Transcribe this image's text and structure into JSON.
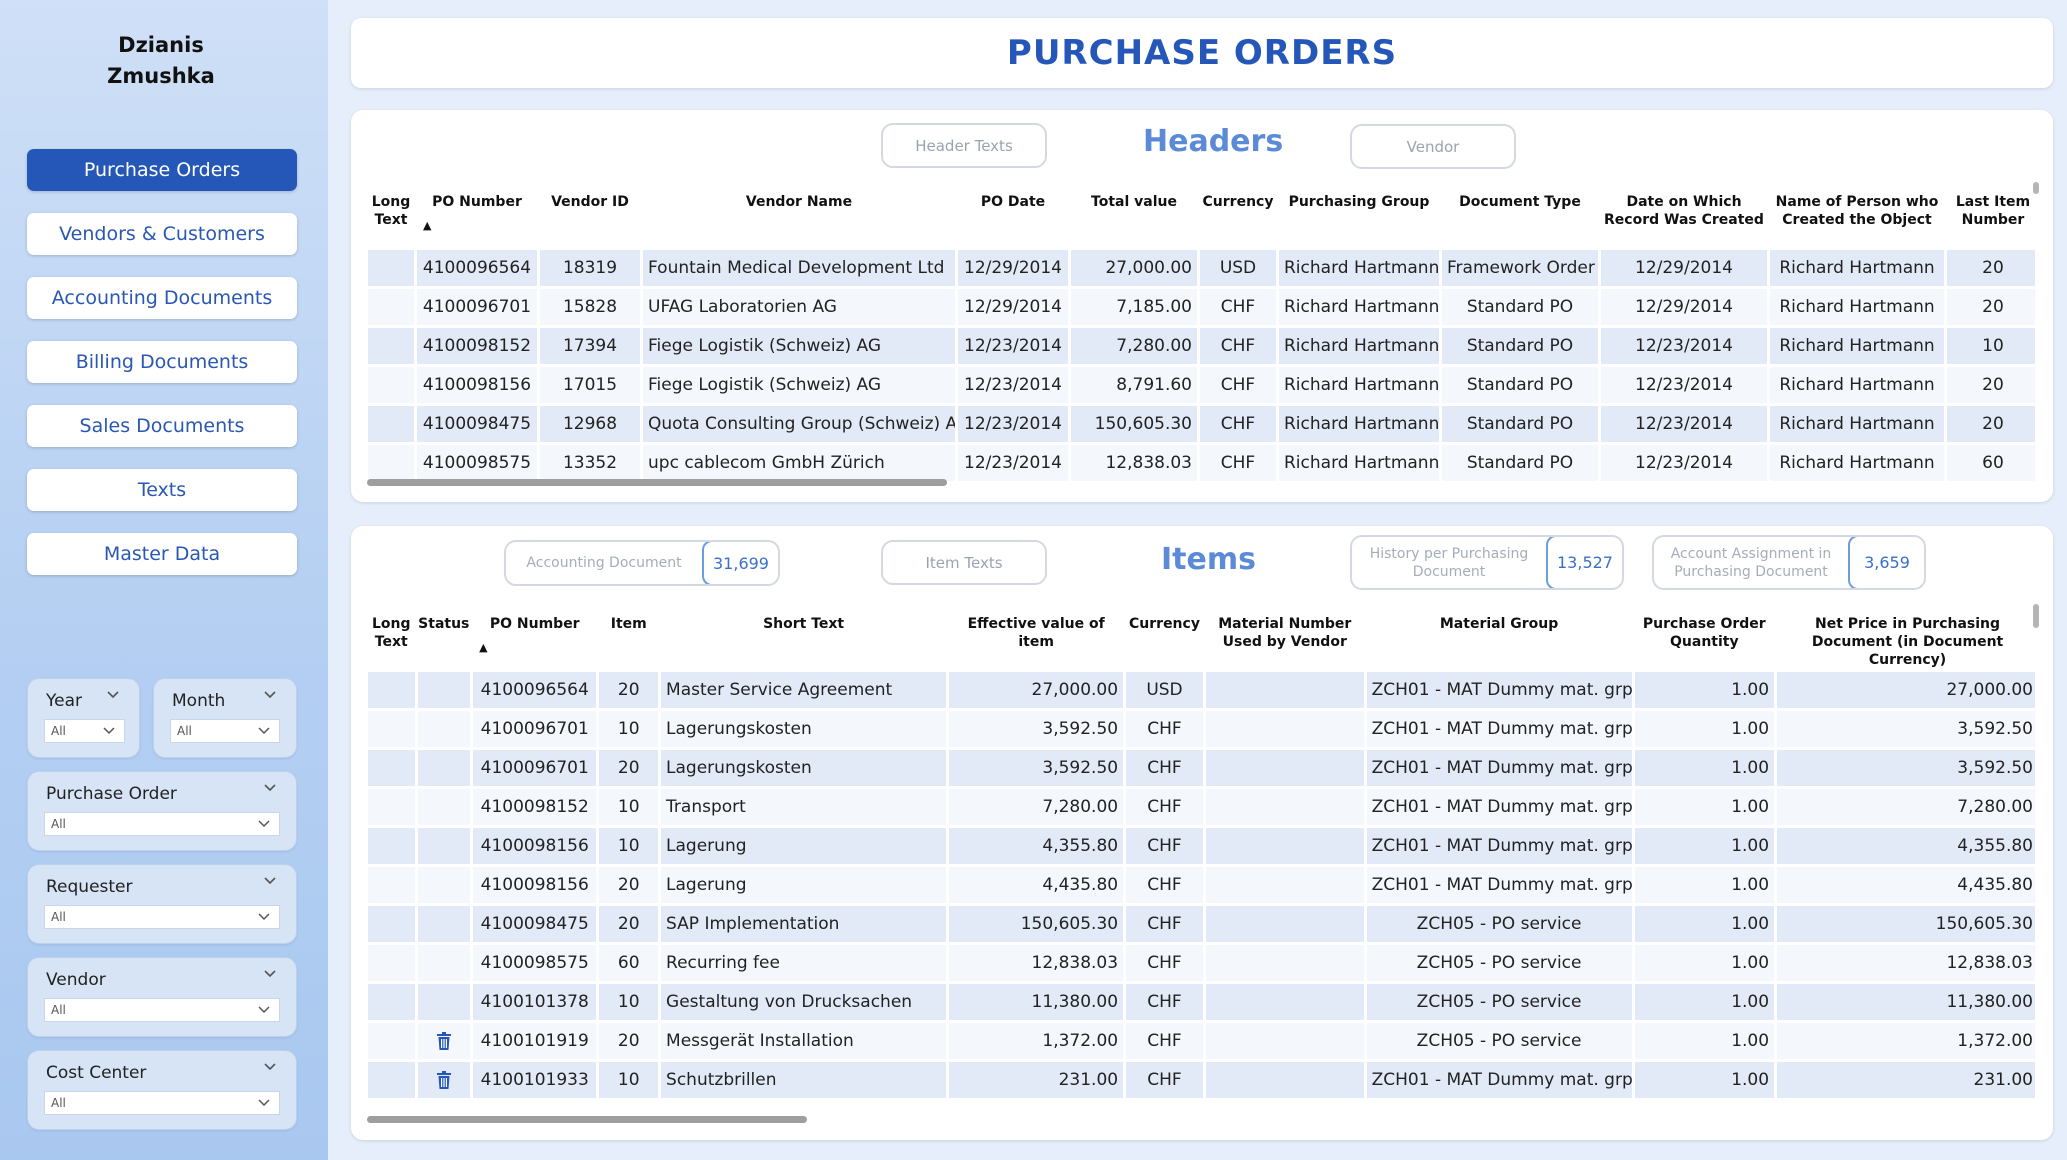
{
  "user": {
    "line1": "Dzianis",
    "line2": "Zmushka"
  },
  "nav": [
    {
      "label": "Purchase Orders",
      "active": true
    },
    {
      "label": "Vendors & Customers",
      "active": false
    },
    {
      "label": "Accounting Documents",
      "active": false
    },
    {
      "label": "Billing Documents",
      "active": false
    },
    {
      "label": "Sales Documents",
      "active": false
    },
    {
      "label": "Texts",
      "active": false
    },
    {
      "label": "Master Data",
      "active": false
    }
  ],
  "filters": {
    "year": {
      "label": "Year",
      "value": "All"
    },
    "month": {
      "label": "Month",
      "value": "All"
    },
    "purchase_order": {
      "label": "Purchase Order",
      "value": "All"
    },
    "requester": {
      "label": "Requester",
      "value": "All"
    },
    "vendor": {
      "label": "Vendor",
      "value": "All"
    },
    "cost_center": {
      "label": "Cost Center",
      "value": "All"
    }
  },
  "page_title": "PURCHASE ORDERS",
  "headers": {
    "title": "Headers",
    "header_texts_button": "Header Texts",
    "vendor_button": "Vendor",
    "columns": [
      "Long Text",
      "PO Number",
      "Vendor ID",
      "Vendor Name",
      "PO Date",
      "Total value",
      "Currency",
      "Purchasing Group",
      "Document Type",
      "Date on Which Record Was Created",
      "Name of Person who Created the Object",
      "Last Item Number"
    ],
    "rows": [
      [
        "",
        "4100096564",
        "18319",
        "Fountain Medical Development Ltd",
        "12/29/2014",
        "27,000.00",
        "USD",
        "Richard Hartmann",
        "Framework Order",
        "12/29/2014",
        "Richard Hartmann",
        "20"
      ],
      [
        "",
        "4100096701",
        "15828",
        "UFAG Laboratorien AG",
        "12/29/2014",
        "7,185.00",
        "CHF",
        "Richard Hartmann",
        "Standard PO",
        "12/29/2014",
        "Richard Hartmann",
        "20"
      ],
      [
        "",
        "4100098152",
        "17394",
        "Fiege Logistik (Schweiz) AG",
        "12/23/2014",
        "7,280.00",
        "CHF",
        "Richard Hartmann",
        "Standard PO",
        "12/23/2014",
        "Richard Hartmann",
        "10"
      ],
      [
        "",
        "4100098156",
        "17015",
        "Fiege Logistik (Schweiz) AG",
        "12/23/2014",
        "8,791.60",
        "CHF",
        "Richard Hartmann",
        "Standard PO",
        "12/23/2014",
        "Richard Hartmann",
        "20"
      ],
      [
        "",
        "4100098475",
        "12968",
        "Quota Consulting Group (Schweiz) AG",
        "12/23/2014",
        "150,605.30",
        "CHF",
        "Richard Hartmann",
        "Standard PO",
        "12/23/2014",
        "Richard Hartmann",
        "20"
      ],
      [
        "",
        "4100098575",
        "13352",
        "upc cablecom GmbH Zürich",
        "12/23/2014",
        "12,838.03",
        "CHF",
        "Richard Hartmann",
        "Standard PO",
        "12/23/2014",
        "Richard Hartmann",
        "60"
      ]
    ]
  },
  "items": {
    "title": "Items",
    "item_texts_button": "Item Texts",
    "kpis": {
      "accounting_document": {
        "label": "Accounting Document",
        "value": "31,699"
      },
      "history": {
        "label": "History per Purchasing Document",
        "value": "13,527"
      },
      "account_assignment": {
        "label": "Account Assignment in Purchasing Document",
        "value": "3,659"
      }
    },
    "columns": [
      "Long Text",
      "Status",
      "PO Number",
      "Item",
      "Short Text",
      "Effective value of item",
      "Currency",
      "Material Number Used by Vendor",
      "Material Group",
      "Purchase Order Quantity",
      "Net Price in Purchasing Document (in Document Currency)"
    ],
    "rows": [
      [
        "",
        "",
        "4100096564",
        "20",
        "Master Service Agreement",
        "27,000.00",
        "USD",
        "",
        "ZCH01 - MAT Dummy mat. grp.",
        "1.00",
        "27,000.00"
      ],
      [
        "",
        "",
        "4100096701",
        "10",
        "Lagerungskosten",
        "3,592.50",
        "CHF",
        "",
        "ZCH01 - MAT Dummy mat. grp.",
        "1.00",
        "3,592.50"
      ],
      [
        "",
        "",
        "4100096701",
        "20",
        "Lagerungskosten",
        "3,592.50",
        "CHF",
        "",
        "ZCH01 - MAT Dummy mat. grp.",
        "1.00",
        "3,592.50"
      ],
      [
        "",
        "",
        "4100098152",
        "10",
        "Transport",
        "7,280.00",
        "CHF",
        "",
        "ZCH01 - MAT Dummy mat. grp.",
        "1.00",
        "7,280.00"
      ],
      [
        "",
        "",
        "4100098156",
        "10",
        "Lagerung",
        "4,355.80",
        "CHF",
        "",
        "ZCH01 - MAT Dummy mat. grp.",
        "1.00",
        "4,355.80"
      ],
      [
        "",
        "",
        "4100098156",
        "20",
        "Lagerung",
        "4,435.80",
        "CHF",
        "",
        "ZCH01 - MAT Dummy mat. grp.",
        "1.00",
        "4,435.80"
      ],
      [
        "",
        "",
        "4100098475",
        "20",
        "SAP Implementation",
        "150,605.30",
        "CHF",
        "",
        "ZCH05 - PO service",
        "1.00",
        "150,605.30"
      ],
      [
        "",
        "",
        "4100098575",
        "60",
        "Recurring fee",
        "12,838.03",
        "CHF",
        "",
        "ZCH05 - PO service",
        "1.00",
        "12,838.03"
      ],
      [
        "",
        "",
        "4100101378",
        "10",
        "Gestaltung von Drucksachen",
        "11,380.00",
        "CHF",
        "",
        "ZCH05 - PO service",
        "1.00",
        "11,380.00"
      ],
      [
        "",
        "trash-icon",
        "4100101919",
        "20",
        "Messgerät Installation",
        "1,372.00",
        "CHF",
        "",
        "ZCH05 - PO service",
        "1.00",
        "1,372.00"
      ],
      [
        "",
        "trash-icon",
        "4100101933",
        "10",
        "Schutzbrillen",
        "231.00",
        "CHF",
        "",
        "ZCH01 - MAT Dummy mat. grp.",
        "1.00",
        "231.00"
      ]
    ]
  },
  "colors": {
    "accent": "#2457b8",
    "section_title": "#5b8ad6",
    "row_shade": "#e2eaf7",
    "row_light": "#f4f7fc"
  }
}
